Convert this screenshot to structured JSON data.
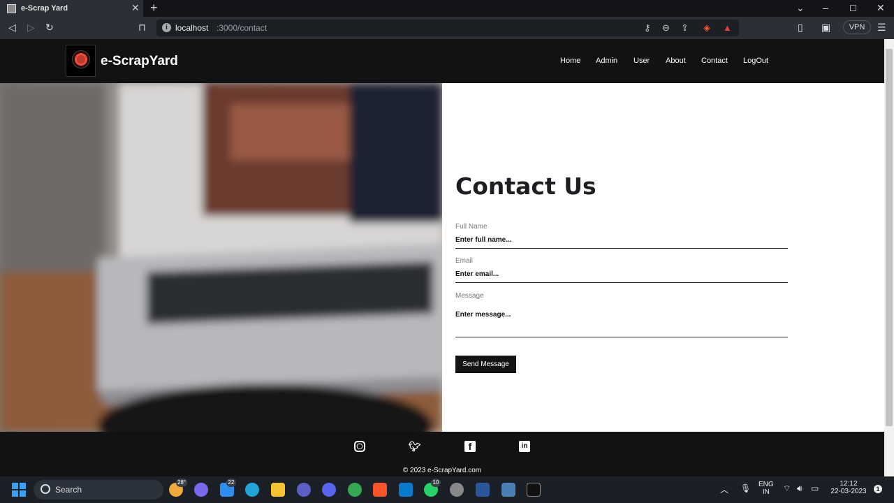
{
  "browser": {
    "tab_title": "e-Scrap Yard",
    "url_host": "localhost",
    "url_path": ":3000/contact",
    "vpn_label": "VPN"
  },
  "navbar": {
    "brand": "e-ScrapYard",
    "links": [
      "Home",
      "Admin",
      "User",
      "About",
      "Contact",
      "LogOut"
    ]
  },
  "contact": {
    "title": "Contact Us",
    "full_name_label": "Full Name",
    "full_name_placeholder": "Enter full name...",
    "email_label": "Email",
    "email_placeholder": "Enter email...",
    "message_label": "Message",
    "message_placeholder": "Enter message...",
    "send_label": "Send Message"
  },
  "footer": {
    "copyright": "© 2023 e-ScrapYard.com"
  },
  "taskbar": {
    "search_label": "Search",
    "weather_temp": "28°",
    "mail_badge": "22",
    "whatsapp_badge": "10",
    "lang_line1": "ENG",
    "lang_line2": "IN",
    "time": "12:12",
    "date": "22-03-2023"
  }
}
